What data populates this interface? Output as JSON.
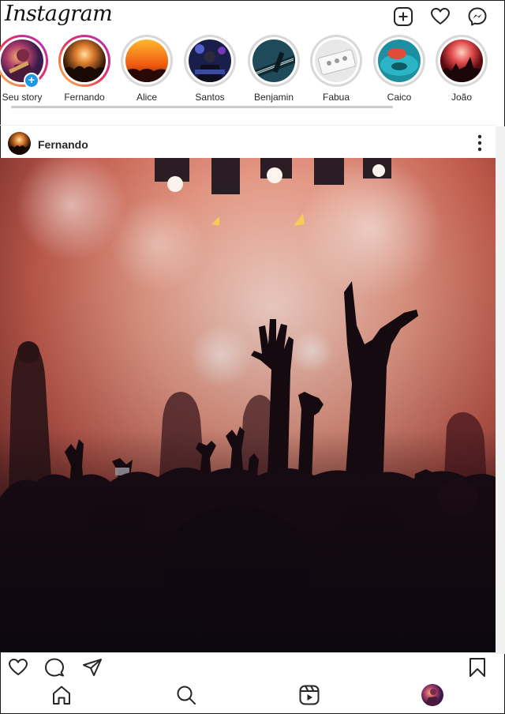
{
  "app": {
    "logo": "Instagram"
  },
  "header": {
    "icons": [
      "new-post-icon",
      "heart-icon",
      "messenger-icon"
    ]
  },
  "stories": [
    {
      "name": "Seu story",
      "state": "active",
      "own": true
    },
    {
      "name": "Fernando",
      "state": "active"
    },
    {
      "name": "Alice",
      "state": "seen"
    },
    {
      "name": "Santos",
      "state": "seen"
    },
    {
      "name": "Benjamin",
      "state": "seen"
    },
    {
      "name": "Fabua",
      "state": "seen"
    },
    {
      "name": "Caico",
      "state": "seen"
    },
    {
      "name": "João",
      "state": "seen"
    }
  ],
  "post": {
    "username": "Fernando"
  },
  "actions": [
    "like-icon",
    "comment-icon",
    "share-icon",
    "save-icon"
  ],
  "bottom_nav": [
    "home-icon",
    "search-icon",
    "reels-icon",
    "profile-avatar"
  ],
  "colors": {
    "story_gradient": [
      "#f9c84a",
      "#e8305d",
      "#b02ec6"
    ],
    "add_badge": "#1e97e8",
    "seen_ring": "#d8d8d8"
  }
}
